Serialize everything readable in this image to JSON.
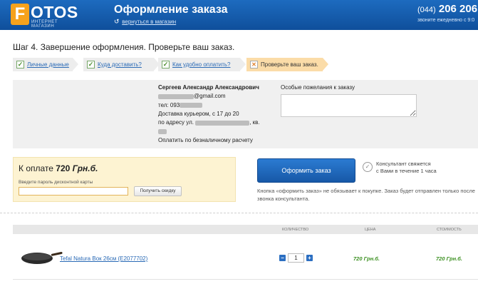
{
  "header": {
    "logo_letter": "F",
    "logo_text": "OTOS",
    "logo_sub": "интернет магазин",
    "title": "Оформление заказа",
    "back_link": "вернуться в магазин",
    "phone_code": "(044)",
    "phone_number": "206 206",
    "phone_sub": "звоните ежедневно с 9:0"
  },
  "step_title": "Шаг 4. Завершение оформления. Проверьте ваш заказ.",
  "steps": [
    {
      "label": "Личные данные",
      "state": "done"
    },
    {
      "label": "Куда доставить?",
      "state": "done"
    },
    {
      "label": "Как удобно оплатить?",
      "state": "done"
    },
    {
      "label": "Проверьте ваш заказ.",
      "state": "active"
    }
  ],
  "customer": {
    "name": "Сергеев Александр Александрович",
    "email_suffix": "@gmail.com",
    "phone_prefix": "тел: 093",
    "delivery": "Доставка курьером, с 17 до 20",
    "address_prefix": "по адресу ул.",
    "address_suffix": ", кв.",
    "payment": "Оплатить по безналичному расчету"
  },
  "wishes": {
    "label": "Особые пожелания к заказу",
    "value": ""
  },
  "payment": {
    "prefix": "К оплате ",
    "amount": "720",
    "currency": "Грн.б.",
    "discount_label": "Введите пароль дисконтной карты",
    "discount_value": "",
    "discount_button": "Получить скидку"
  },
  "order": {
    "button": "Оформить заказ",
    "consult_line1": "Консультант свяжется",
    "consult_line2": "с Вами в течение 1 часа",
    "note": "Кнопка «оформить заказ» не обязывает к покупке. Заказ будет отправлен только после звонка консультанта."
  },
  "cart": {
    "columns": {
      "quantity": "количество",
      "price": "цена",
      "total": "стоимость"
    },
    "rows": [
      {
        "name": "Tefal Natura Вок 26см (E2077702)",
        "quantity": "1",
        "price": "720 Грн.б.",
        "total": "720 Грн.б."
      }
    ]
  },
  "colors": {
    "header": "#1d6bbf",
    "accent": "#f6a21c",
    "price": "#3a8f1f",
    "button": "#1f66bb"
  }
}
